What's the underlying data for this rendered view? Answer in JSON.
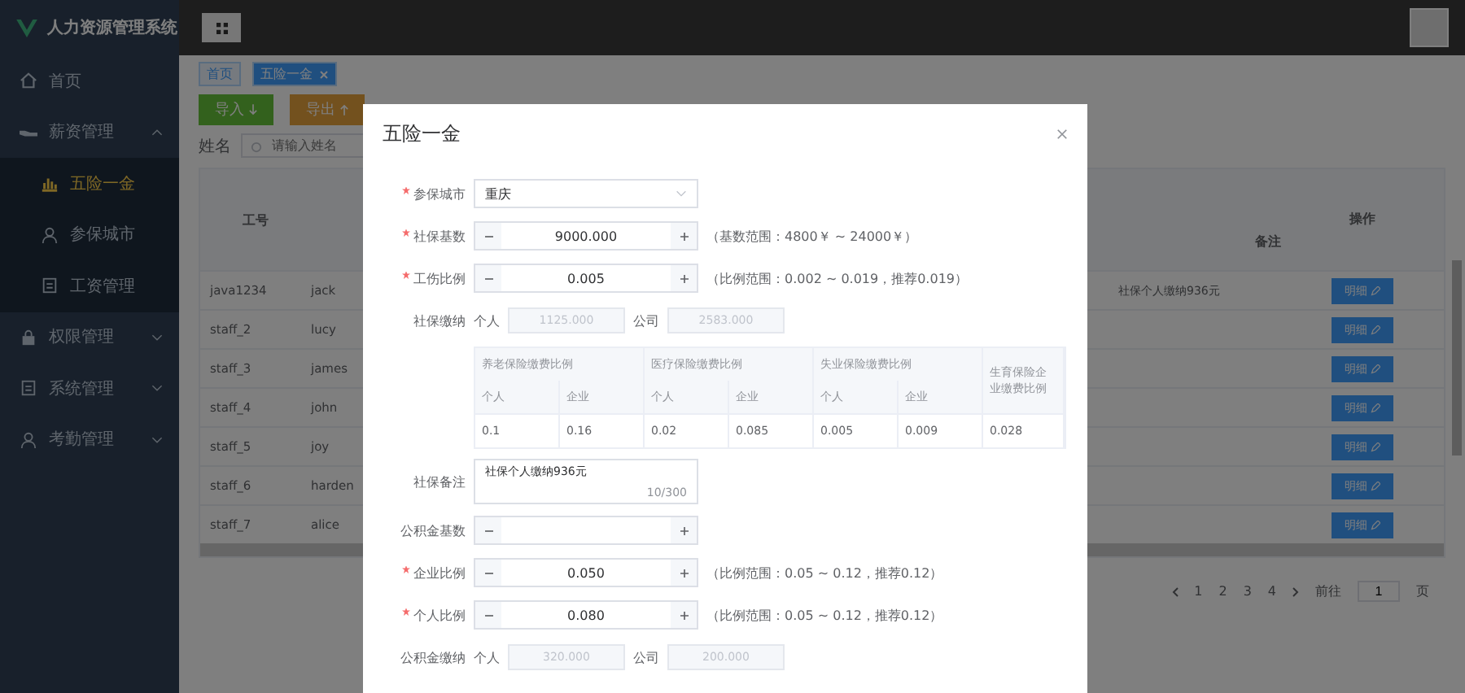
{
  "app_title": "人力资源管理系统",
  "sidebar": {
    "items": [
      {
        "label": "首页",
        "selected": false
      },
      {
        "label": "薪资管理",
        "expanded": true,
        "selected": false,
        "children": [
          {
            "label": "五险一金",
            "selected": true
          },
          {
            "label": "参保城市",
            "selected": false
          },
          {
            "label": "工资管理",
            "selected": false
          }
        ]
      },
      {
        "label": "权限管理",
        "expanded": false,
        "selected": false
      },
      {
        "label": "系统管理",
        "expanded": false,
        "selected": false
      },
      {
        "label": "考勤管理",
        "expanded": false,
        "selected": false
      }
    ]
  },
  "breadcrumb_tags": [
    {
      "label": "首页",
      "closable": false,
      "selected": false
    },
    {
      "label": "五险一金",
      "closable": true,
      "selected": true
    }
  ],
  "toolbar": [
    {
      "label": "导入",
      "kind": "import"
    },
    {
      "label": "导出",
      "kind": "export"
    }
  ],
  "filter": {
    "label": "姓名",
    "placeholder": "请输入姓名"
  },
  "table": {
    "columns": [
      "工号",
      "备注",
      "操作"
    ],
    "rows": [
      {
        "id": "java1234",
        "name": "jack",
        "remark": "社保个人缴纳936元",
        "action": "明细"
      },
      {
        "id": "staff_2",
        "name": "lucy",
        "action": "明细"
      },
      {
        "id": "staff_3",
        "name": "james",
        "action": "明细"
      },
      {
        "id": "staff_4",
        "name": "john",
        "action": "明细"
      },
      {
        "id": "staff_5",
        "name": "joy",
        "action": "明细"
      },
      {
        "id": "staff_6",
        "name": "harden",
        "action": "明细"
      },
      {
        "id": "staff_7",
        "name": "alice",
        "action": "明细"
      }
    ]
  },
  "pagination": {
    "pages": [
      {
        "label": "1",
        "selected": false
      },
      {
        "label": "2",
        "selected": false
      },
      {
        "label": "3",
        "selected": false
      },
      {
        "label": "4",
        "selected": false
      }
    ],
    "goto_label": "前往",
    "goto_value": "1",
    "page_suffix": "页"
  },
  "dialog": {
    "title": "五险一金",
    "fields": [
      {
        "kind": "select",
        "label": "参保城市",
        "required": true,
        "value": "重庆"
      },
      {
        "kind": "stepper",
        "label": "社保基数",
        "required": true,
        "value": "9000.000",
        "hint": "（基数范围：4800￥ ~ 24000￥）"
      },
      {
        "kind": "stepper",
        "label": "工伤比例",
        "required": true,
        "value": "0.005",
        "hint": "（比例范围：0.002 ~ 0.019，推荐0.019）"
      },
      {
        "kind": "pair",
        "label": "社保缴纳",
        "required": false,
        "personal_label": "个人",
        "personal": "1125.000",
        "company_label": "公司",
        "company": "2583.000"
      },
      {
        "kind": "rates",
        "groups": [
          "养老保险缴费比例",
          "医疗保险缴费比例",
          "失业保险缴费比例"
        ],
        "sub_headers": [
          "个人",
          "企业",
          "个人",
          "企业",
          "个人",
          "企业"
        ],
        "last": "生育保险企业缴费比例",
        "values": [
          "0.1",
          "0.16",
          "0.02",
          "0.085",
          "0.005",
          "0.009",
          "0.028"
        ]
      },
      {
        "kind": "textarea",
        "label": "社保备注",
        "required": false,
        "value": "社保个人缴纳936元",
        "count": "10/300"
      },
      {
        "kind": "stepper",
        "label": "公积金基数",
        "required": false
      },
      {
        "kind": "stepper",
        "label": "企业比例",
        "required": true,
        "value": "0.050",
        "hint": "（比例范围：0.05 ~ 0.12，推荐0.12）"
      },
      {
        "kind": "stepper",
        "label": "个人比例",
        "required": true,
        "value": "0.080",
        "hint": "（比例范围：0.05 ~ 0.12，推荐0.12）"
      },
      {
        "kind": "pair",
        "label": "公积金缴纳",
        "required": false,
        "personal_label": "个人",
        "personal": "320.000",
        "company_label": "公司",
        "company": "200.000"
      }
    ]
  }
}
